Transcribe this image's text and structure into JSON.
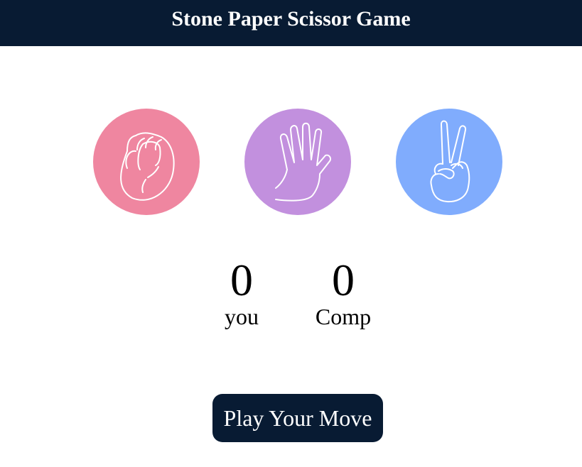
{
  "header": {
    "title": "Stone Paper Scissor Game"
  },
  "choices": [
    {
      "name": "rock",
      "icon": "fist-icon",
      "color": "#ef86a0"
    },
    {
      "name": "paper",
      "icon": "open-hand-icon",
      "color": "#c290de"
    },
    {
      "name": "scissor",
      "icon": "victory-hand-icon",
      "color": "#80acfd"
    }
  ],
  "scoreboard": {
    "user_score": "0",
    "user_label": "you",
    "comp_score": "0",
    "comp_label": "Comp"
  },
  "message": {
    "text": "Play Your Move",
    "color": "#081b33"
  },
  "theme": {
    "header_bg": "#081b33"
  }
}
